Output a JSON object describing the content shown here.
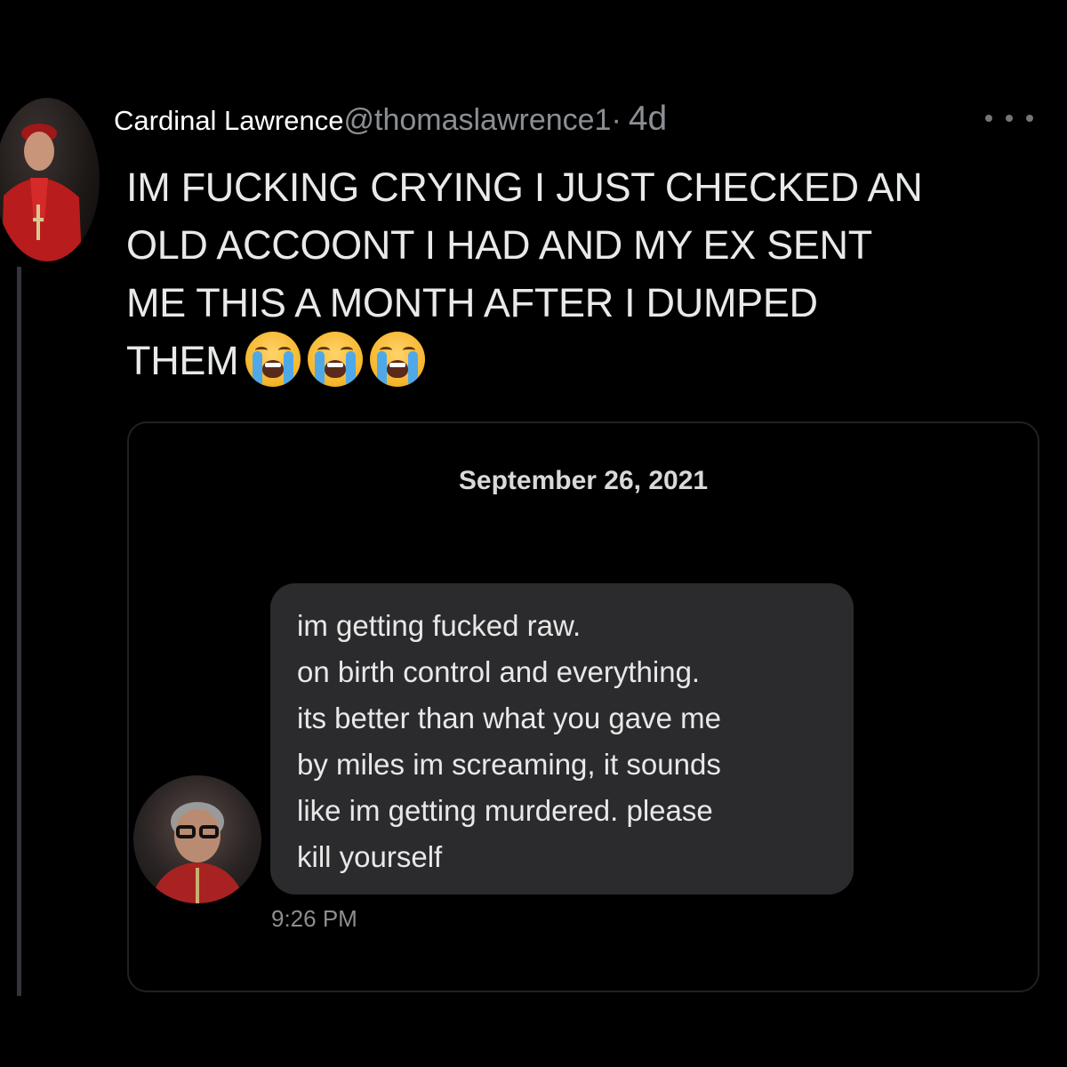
{
  "post": {
    "display_name": "Cardinal Lawrence",
    "handle": "@thomaslawrence1",
    "separator": "·",
    "time_ago": "4d",
    "text_lines": [
      "IM FUCKING CRYING I JUST CHECKED AN",
      "OLD ACCOONT I HAD AND MY EX SENT",
      "ME THIS A MONTH AFTER I DUMPED",
      "THEM"
    ],
    "emojis": [
      "loudly-crying-face-icon",
      "loudly-crying-face-icon",
      "loudly-crying-face-icon"
    ]
  },
  "embedded_screenshot": {
    "date_header": "September 26, 2021",
    "message_lines": [
      "im getting fucked raw.",
      "on birth control and everything.",
      "its better than what you gave me",
      "by miles im screaming, it sounds",
      "like im getting murdered.  please",
      "kill yourself"
    ],
    "message_time": "9:26 PM"
  },
  "colors": {
    "background": "#000000",
    "secondary_text": "#8b8f94",
    "bubble": "#2b2b2d",
    "thread_line": "#333639"
  }
}
